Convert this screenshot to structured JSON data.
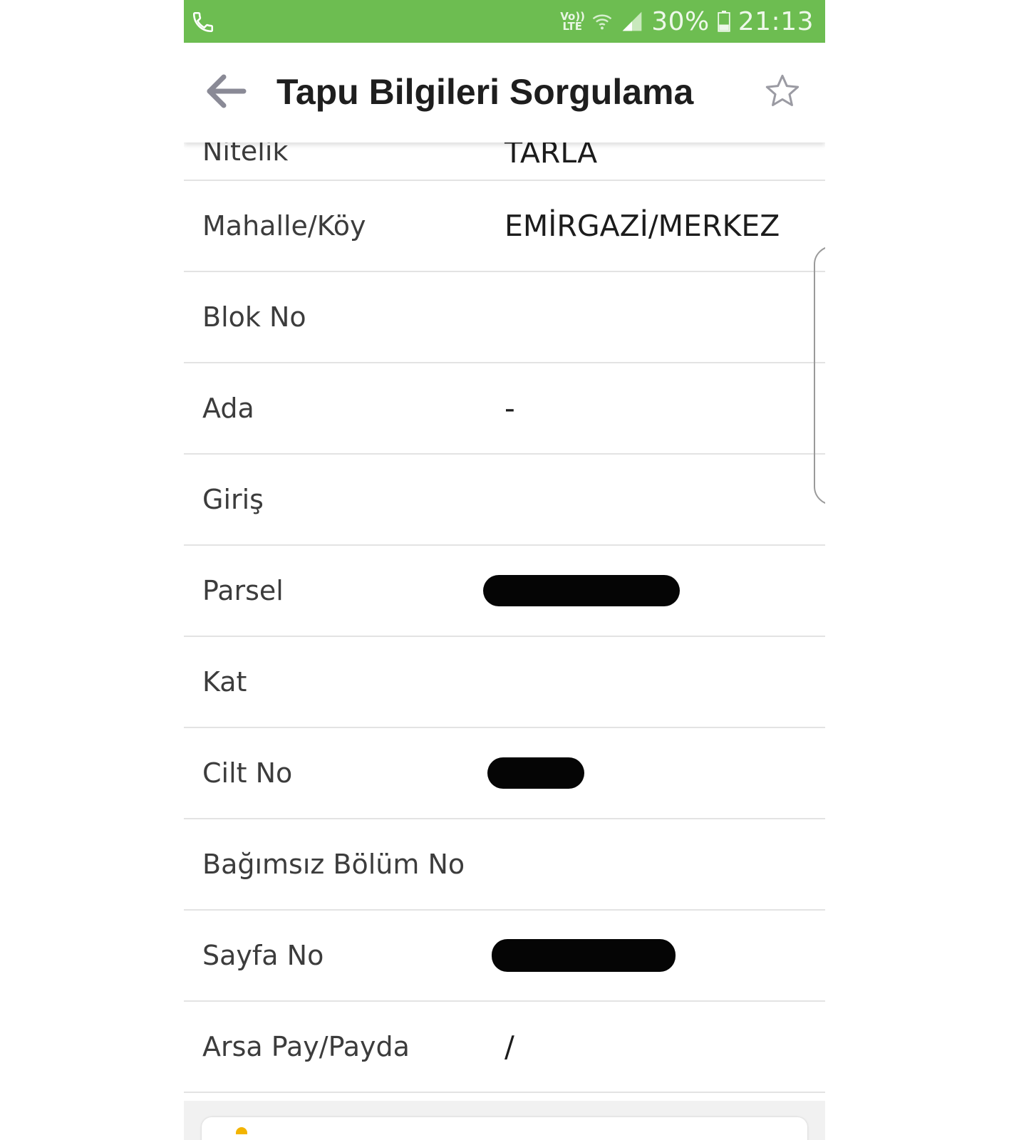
{
  "status_bar": {
    "volte_label": "Vo)) LTE",
    "battery": "30%",
    "time": "21:13",
    "background_color": "#6dbd51"
  },
  "app_bar": {
    "title": "Tapu Bilgileri Sorgulama",
    "back_icon": "arrow-left-icon",
    "favorite_icon": "star-outline-icon"
  },
  "rows": [
    {
      "label": "Nitelik",
      "value": "TARLA"
    },
    {
      "label": "Mahalle/Köy",
      "value": "EMİRGAZİ/MERKEZ"
    },
    {
      "label": "Blok No",
      "value": ""
    },
    {
      "label": "Ada",
      "value": "-"
    },
    {
      "label": "Giriş",
      "value": ""
    },
    {
      "label": "Parsel",
      "value": ""
    },
    {
      "label": "Kat",
      "value": ""
    },
    {
      "label": "Cilt No",
      "value": ""
    },
    {
      "label": "Bağımsız Bölüm No",
      "value": ""
    },
    {
      "label": "Sayfa No",
      "value": ""
    },
    {
      "label": "Arsa Pay/Payda",
      "value": "/"
    }
  ]
}
